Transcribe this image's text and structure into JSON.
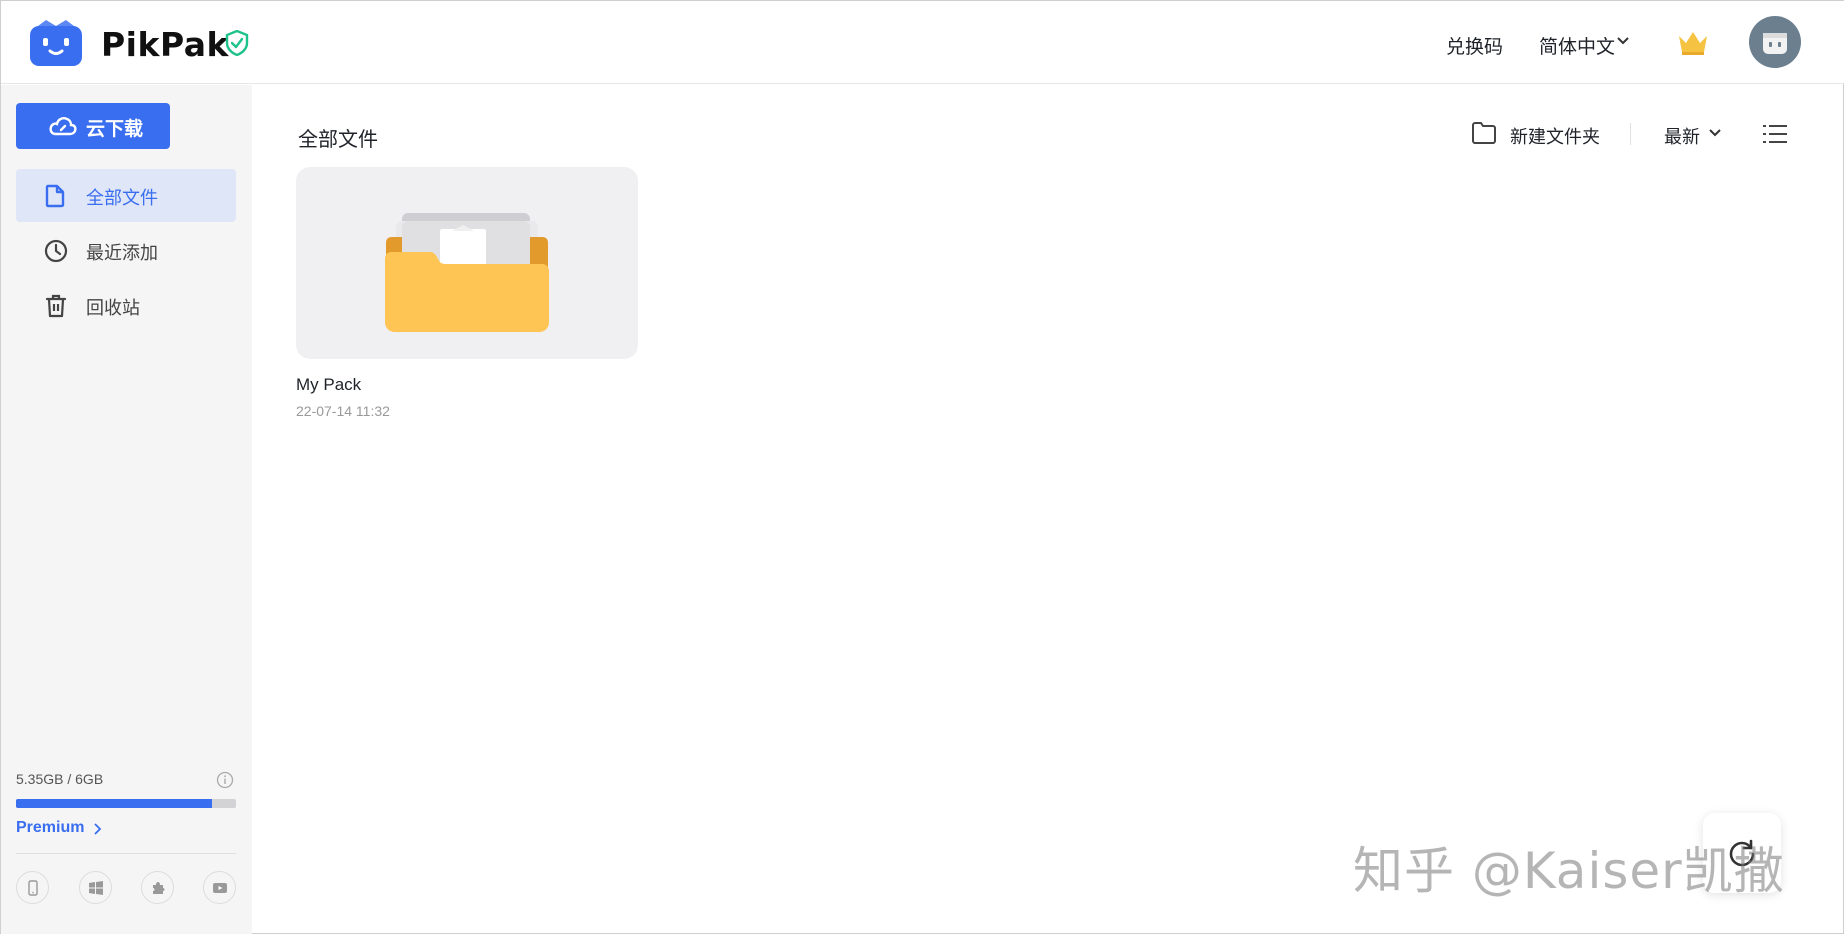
{
  "app": {
    "brand": "PikPak",
    "colors": {
      "accent": "#3a6ef0",
      "shield": "#1ec28b",
      "crown": "#f5c242",
      "folder": "#ffc554"
    }
  },
  "header": {
    "redeem_label": "兑换码",
    "language_label": "简体中文",
    "icons": [
      "pikpak-logo-icon",
      "shield-check-icon",
      "chevron-down-icon",
      "crown-icon",
      "avatar-icon"
    ]
  },
  "sidebar": {
    "cloud_download_label": "云下载",
    "items": [
      {
        "label": "全部文件",
        "icon": "file-icon",
        "active": true
      },
      {
        "label": "最近添加",
        "icon": "clock-icon",
        "active": false
      },
      {
        "label": "回收站",
        "icon": "trash-icon",
        "active": false
      }
    ],
    "storage": {
      "text": "5.35GB / 6GB",
      "used_fraction": 0.892
    },
    "premium_label": "Premium",
    "platform_icons": [
      "mobile-icon",
      "windows-icon",
      "extension-icon",
      "tv-icon"
    ]
  },
  "main": {
    "title": "全部文件",
    "new_folder_label": "新建文件夹",
    "sort_label": "最新",
    "files": [
      {
        "name": "My Pack",
        "date": "22-07-14 11:32",
        "type": "folder"
      }
    ]
  },
  "watermark": "知乎 @Kaiser凯撒"
}
